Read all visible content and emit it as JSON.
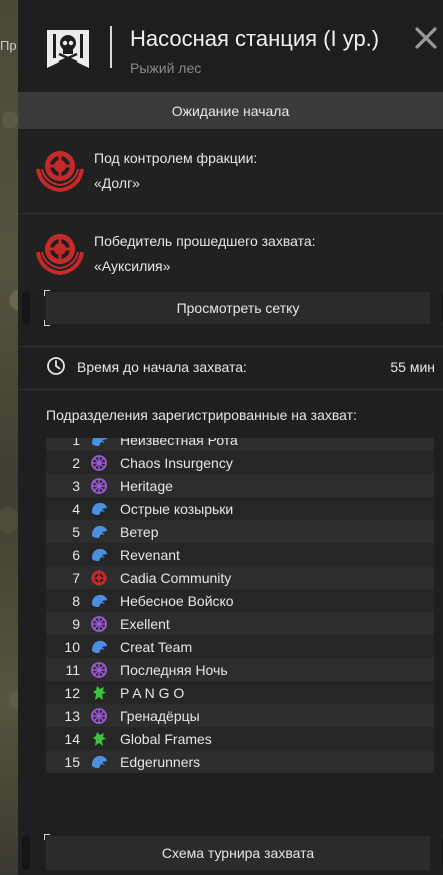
{
  "map": {
    "label": "Пр"
  },
  "header": {
    "title": "Насосная станция (I ур.)",
    "subtitle": "Рыжий лес",
    "emblem": "skull-flag-icon",
    "close": "close-icon"
  },
  "status": {
    "text": "Ожидание начала"
  },
  "controller": {
    "label": "Под контролем фракции:",
    "value": "«Долг»",
    "emblem": "duty-crest-icon"
  },
  "previous_winner": {
    "label": "Победитель прошедшего захвата:",
    "value": "«Ауксилия»",
    "emblem": "duty-crest-icon"
  },
  "buttons": {
    "view_grid": "Просмотреть сетку",
    "tournament_scheme": "Схема турнира захвата"
  },
  "timer": {
    "label": "Время до начала захвата:",
    "value": "55 мин",
    "icon": "clock-icon"
  },
  "units_title": "Подразделения зарегистрированные на захват:",
  "colors": {
    "panel": "#1f1f1f",
    "blue_faction": "#4a8fe0",
    "purple_faction": "#9b59d9",
    "red_faction": "#c42a2a",
    "green_faction": "#3ec23e"
  },
  "units": [
    {
      "rank": "1",
      "name": "Неизвестная Рота",
      "icon": "blue"
    },
    {
      "rank": "2",
      "name": "Chaos Insurgency",
      "icon": "purple"
    },
    {
      "rank": "3",
      "name": "Heritage",
      "icon": "purple"
    },
    {
      "rank": "4",
      "name": "Острые козырьки",
      "icon": "blue"
    },
    {
      "rank": "5",
      "name": "Ветер",
      "icon": "blue"
    },
    {
      "rank": "6",
      "name": "Revenant",
      "icon": "blue"
    },
    {
      "rank": "7",
      "name": "Cadia Community",
      "icon": "red"
    },
    {
      "rank": "8",
      "name": "Небесное Войско",
      "icon": "blue"
    },
    {
      "rank": "9",
      "name": "Exellent",
      "icon": "purple"
    },
    {
      "rank": "10",
      "name": "Creat Team",
      "icon": "blue"
    },
    {
      "rank": "11",
      "name": "Последняя Ночь",
      "icon": "purple"
    },
    {
      "rank": "12",
      "name": "P A N G O",
      "icon": "green"
    },
    {
      "rank": "13",
      "name": "Гренадёрцы",
      "icon": "purple"
    },
    {
      "rank": "14",
      "name": "Global Frames",
      "icon": "green"
    },
    {
      "rank": "15",
      "name": "Edgerunners",
      "icon": "blue"
    }
  ]
}
